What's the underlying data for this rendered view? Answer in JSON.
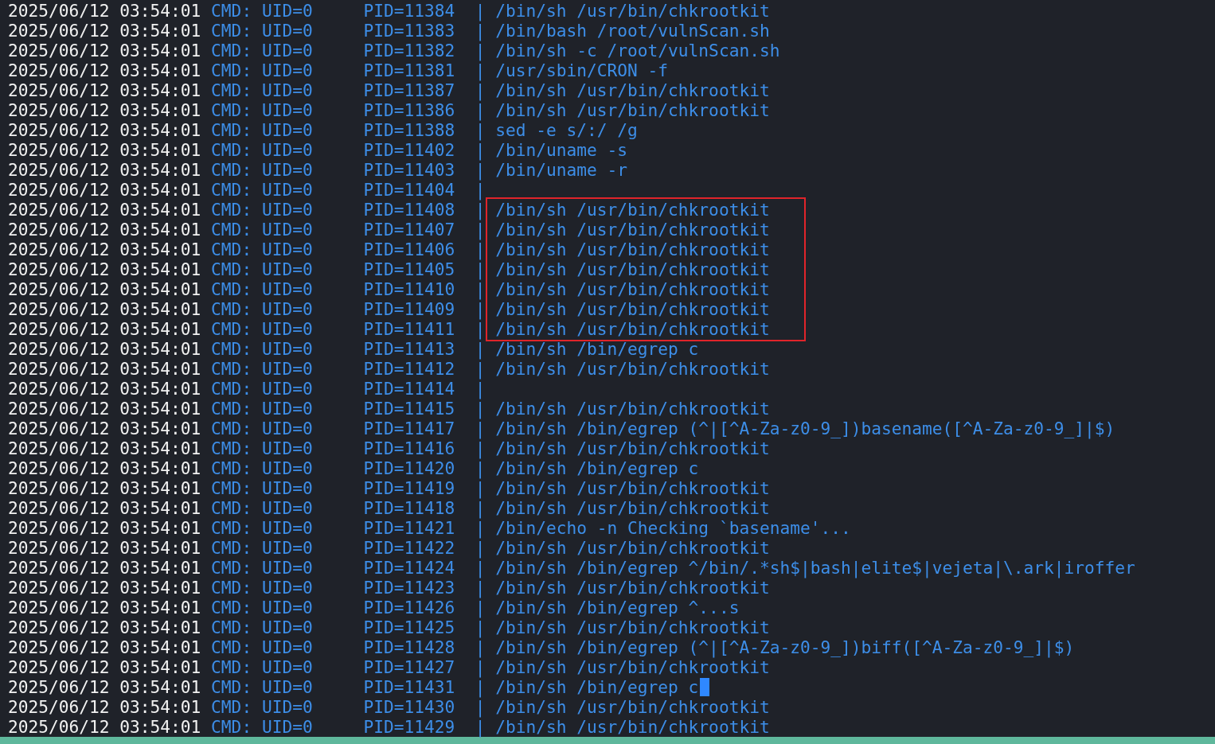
{
  "terminal": {
    "sections": [
      {
        "boxed": false,
        "rows": [
          {
            "time": "2025/06/12 03:54:01",
            "uid": "CMD: UID=0",
            "pid": "PID=11384",
            "sep": "|",
            "command": "/bin/sh /usr/bin/chkrootkit",
            "cursor": false
          },
          {
            "time": "2025/06/12 03:54:01",
            "uid": "CMD: UID=0",
            "pid": "PID=11383",
            "sep": "|",
            "command": "/bin/bash /root/vulnScan.sh",
            "cursor": false
          },
          {
            "time": "2025/06/12 03:54:01",
            "uid": "CMD: UID=0",
            "pid": "PID=11382",
            "sep": "|",
            "command": "/bin/sh -c /root/vulnScan.sh",
            "cursor": false
          },
          {
            "time": "2025/06/12 03:54:01",
            "uid": "CMD: UID=0",
            "pid": "PID=11381",
            "sep": "|",
            "command": "/usr/sbin/CRON -f",
            "cursor": false
          },
          {
            "time": "2025/06/12 03:54:01",
            "uid": "CMD: UID=0",
            "pid": "PID=11387",
            "sep": "|",
            "command": "/bin/sh /usr/bin/chkrootkit",
            "cursor": false
          },
          {
            "time": "2025/06/12 03:54:01",
            "uid": "CMD: UID=0",
            "pid": "PID=11386",
            "sep": "|",
            "command": "/bin/sh /usr/bin/chkrootkit",
            "cursor": false
          },
          {
            "time": "2025/06/12 03:54:01",
            "uid": "CMD: UID=0",
            "pid": "PID=11388",
            "sep": "|",
            "command": "sed -e s/:/ /g",
            "cursor": false
          },
          {
            "time": "2025/06/12 03:54:01",
            "uid": "CMD: UID=0",
            "pid": "PID=11402",
            "sep": "|",
            "command": "/bin/uname -s",
            "cursor": false
          },
          {
            "time": "2025/06/12 03:54:01",
            "uid": "CMD: UID=0",
            "pid": "PID=11403",
            "sep": "|",
            "command": "/bin/uname -r",
            "cursor": false
          },
          {
            "time": "2025/06/12 03:54:01",
            "uid": "CMD: UID=0",
            "pid": "PID=11404",
            "sep": "|",
            "cursor": false
          }
        ]
      },
      {
        "boxed": true,
        "rows": [
          {
            "time": "2025/06/12 03:54:01",
            "uid": "CMD: UID=0",
            "pid": "PID=11408",
            "sep": "|",
            "command": "/bin/sh /usr/bin/chkrootkit",
            "cursor": false
          },
          {
            "time": "2025/06/12 03:54:01",
            "uid": "CMD: UID=0",
            "pid": "PID=11407",
            "sep": "|",
            "command": "/bin/sh /usr/bin/chkrootkit",
            "cursor": false
          },
          {
            "time": "2025/06/12 03:54:01",
            "uid": "CMD: UID=0",
            "pid": "PID=11406",
            "sep": "|",
            "command": "/bin/sh /usr/bin/chkrootkit",
            "cursor": false
          },
          {
            "time": "2025/06/12 03:54:01",
            "uid": "CMD: UID=0",
            "pid": "PID=11405",
            "sep": "|",
            "command": "/bin/sh /usr/bin/chkrootkit",
            "cursor": false
          },
          {
            "time": "2025/06/12 03:54:01",
            "uid": "CMD: UID=0",
            "pid": "PID=11410",
            "sep": "|",
            "command": "/bin/sh /usr/bin/chkrootkit",
            "cursor": false
          },
          {
            "time": "2025/06/12 03:54:01",
            "uid": "CMD: UID=0",
            "pid": "PID=11409",
            "sep": "|",
            "command": "/bin/sh /usr/bin/chkrootkit",
            "cursor": false
          },
          {
            "time": "2025/06/12 03:54:01",
            "uid": "CMD: UID=0",
            "pid": "PID=11411",
            "sep": "|",
            "command": "/bin/sh /usr/bin/chkrootkit",
            "cursor": false
          }
        ]
      },
      {
        "boxed": false,
        "rows": [
          {
            "time": "2025/06/12 03:54:01",
            "uid": "CMD: UID=0",
            "pid": "PID=11413",
            "sep": "|",
            "command": "/bin/sh /bin/egrep c",
            "cursor": false
          },
          {
            "time": "2025/06/12 03:54:01",
            "uid": "CMD: UID=0",
            "pid": "PID=11412",
            "sep": "|",
            "command": "/bin/sh /usr/bin/chkrootkit",
            "cursor": false
          },
          {
            "time": "2025/06/12 03:54:01",
            "uid": "CMD: UID=0",
            "pid": "PID=11414",
            "sep": "|",
            "cursor": false
          },
          {
            "time": "2025/06/12 03:54:01",
            "uid": "CMD: UID=0",
            "pid": "PID=11415",
            "sep": "|",
            "command": "/bin/sh /usr/bin/chkrootkit",
            "cursor": false
          },
          {
            "time": "2025/06/12 03:54:01",
            "uid": "CMD: UID=0",
            "pid": "PID=11417",
            "sep": "|",
            "command": "/bin/sh /bin/egrep (^|[^A-Za-z0-9_])basename([^A-Za-z0-9_]|$)",
            "cursor": false
          },
          {
            "time": "2025/06/12 03:54:01",
            "uid": "CMD: UID=0",
            "pid": "PID=11416",
            "sep": "|",
            "command": "/bin/sh /usr/bin/chkrootkit",
            "cursor": false
          },
          {
            "time": "2025/06/12 03:54:01",
            "uid": "CMD: UID=0",
            "pid": "PID=11420",
            "sep": "|",
            "command": "/bin/sh /bin/egrep c",
            "cursor": false
          },
          {
            "time": "2025/06/12 03:54:01",
            "uid": "CMD: UID=0",
            "pid": "PID=11419",
            "sep": "|",
            "command": "/bin/sh /usr/bin/chkrootkit",
            "cursor": false
          },
          {
            "time": "2025/06/12 03:54:01",
            "uid": "CMD: UID=0",
            "pid": "PID=11418",
            "sep": "|",
            "command": "/bin/sh /usr/bin/chkrootkit",
            "cursor": false
          },
          {
            "time": "2025/06/12 03:54:01",
            "uid": "CMD: UID=0",
            "pid": "PID=11421",
            "sep": "|",
            "command": "/bin/echo -n Checking `basename'...",
            "cursor": false
          },
          {
            "time": "2025/06/12 03:54:01",
            "uid": "CMD: UID=0",
            "pid": "PID=11422",
            "sep": "|",
            "command": "/bin/sh /usr/bin/chkrootkit",
            "cursor": false
          },
          {
            "time": "2025/06/12 03:54:01",
            "uid": "CMD: UID=0",
            "pid": "PID=11424",
            "sep": "|",
            "command": "/bin/sh /bin/egrep ^/bin/.*sh$|bash|elite$|vejeta|\\.ark|iroffer",
            "cursor": false
          },
          {
            "time": "2025/06/12 03:54:01",
            "uid": "CMD: UID=0",
            "pid": "PID=11423",
            "sep": "|",
            "command": "/bin/sh /usr/bin/chkrootkit",
            "cursor": false
          },
          {
            "time": "2025/06/12 03:54:01",
            "uid": "CMD: UID=0",
            "pid": "PID=11426",
            "sep": "|",
            "command": "/bin/sh /bin/egrep ^...s",
            "cursor": false
          },
          {
            "time": "2025/06/12 03:54:01",
            "uid": "CMD: UID=0",
            "pid": "PID=11425",
            "sep": "|",
            "command": "/bin/sh /usr/bin/chkrootkit",
            "cursor": false
          },
          {
            "time": "2025/06/12 03:54:01",
            "uid": "CMD: UID=0",
            "pid": "PID=11428",
            "sep": "|",
            "command": "/bin/sh /bin/egrep (^|[^A-Za-z0-9_])biff([^A-Za-z0-9_]|$)",
            "cursor": false
          },
          {
            "time": "2025/06/12 03:54:01",
            "uid": "CMD: UID=0",
            "pid": "PID=11427",
            "sep": "|",
            "command": "/bin/sh /usr/bin/chkrootkit",
            "cursor": false
          },
          {
            "time": "2025/06/12 03:54:01",
            "uid": "CMD: UID=0",
            "pid": "PID=11431",
            "sep": "|",
            "command": "/bin/sh /bin/egrep c",
            "cursor": true
          },
          {
            "time": "2025/06/12 03:54:01",
            "uid": "CMD: UID=0",
            "pid": "PID=11430",
            "sep": "|",
            "command": "/bin/sh /usr/bin/chkrootkit",
            "cursor": false
          },
          {
            "time": "2025/06/12 03:54:01",
            "uid": "CMD: UID=0",
            "pid": "PID=11429",
            "sep": "|",
            "command": "/bin/sh /usr/bin/chkrootkit",
            "cursor": false
          }
        ]
      }
    ]
  }
}
